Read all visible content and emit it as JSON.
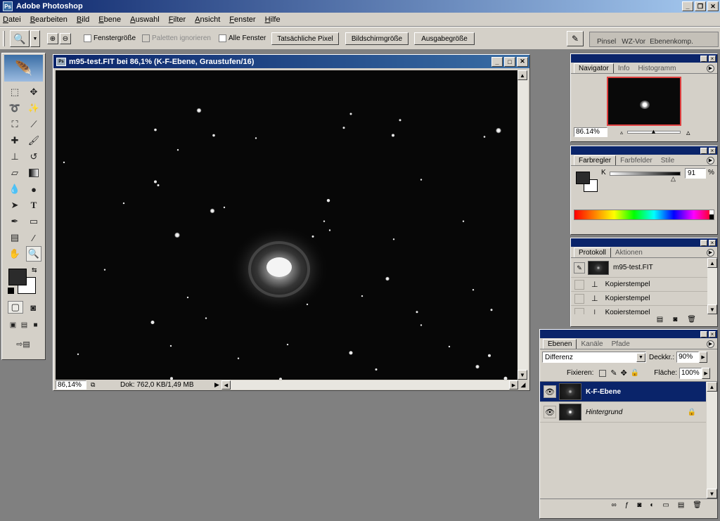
{
  "app": {
    "title": "Adobe Photoshop",
    "menu": [
      "Datei",
      "Bearbeiten",
      "Bild",
      "Ebene",
      "Auswahl",
      "Filter",
      "Ansicht",
      "Fenster",
      "Hilfe"
    ]
  },
  "options": {
    "fenstergroesse": "Fenstergröße",
    "paletten": "Paletten ignorieren",
    "alle_fenster": "Alle Fenster",
    "btn_pixel": "Tatsächliche Pixel",
    "btn_bildschirm": "Bildschirmgröße",
    "btn_ausgabe": "Ausgabegröße",
    "well_tabs": [
      "Pinsel",
      "WZ-Vor",
      "Ebenenkomp."
    ]
  },
  "document": {
    "title": "m95-test.FIT bei 86,1% (K-F-Ebene, Graustufen/16)",
    "zoom": "86,14%",
    "doc_info": "Dok: 762,0 KB/1,49 MB"
  },
  "navigator": {
    "tabs": [
      "Navigator",
      "Info",
      "Histogramm"
    ],
    "zoom": "86.14%"
  },
  "color": {
    "tabs": [
      "Farbregler",
      "Farbfelder",
      "Stile"
    ],
    "channel": "K",
    "value": "91",
    "unit": "%",
    "fg": "#2b2b2b",
    "bg": "#ffffff"
  },
  "history": {
    "tabs": [
      "Protokoll",
      "Aktionen"
    ],
    "snapshot": "m95-test.FIT",
    "items": [
      "Kopierstempel",
      "Kopierstempel",
      "Kopierstempel"
    ]
  },
  "layers": {
    "tabs": [
      "Ebenen",
      "Kanäle",
      "Pfade"
    ],
    "blend_mode": "Differenz",
    "opacity_label": "Deckkr.:",
    "opacity": "90%",
    "lock_label": "Fixieren:",
    "fill_label": "Fläche:",
    "fill": "100%",
    "items": [
      {
        "name": "K-F-Ebene",
        "selected": true
      },
      {
        "name": "Hintergrund",
        "selected": false
      }
    ]
  }
}
